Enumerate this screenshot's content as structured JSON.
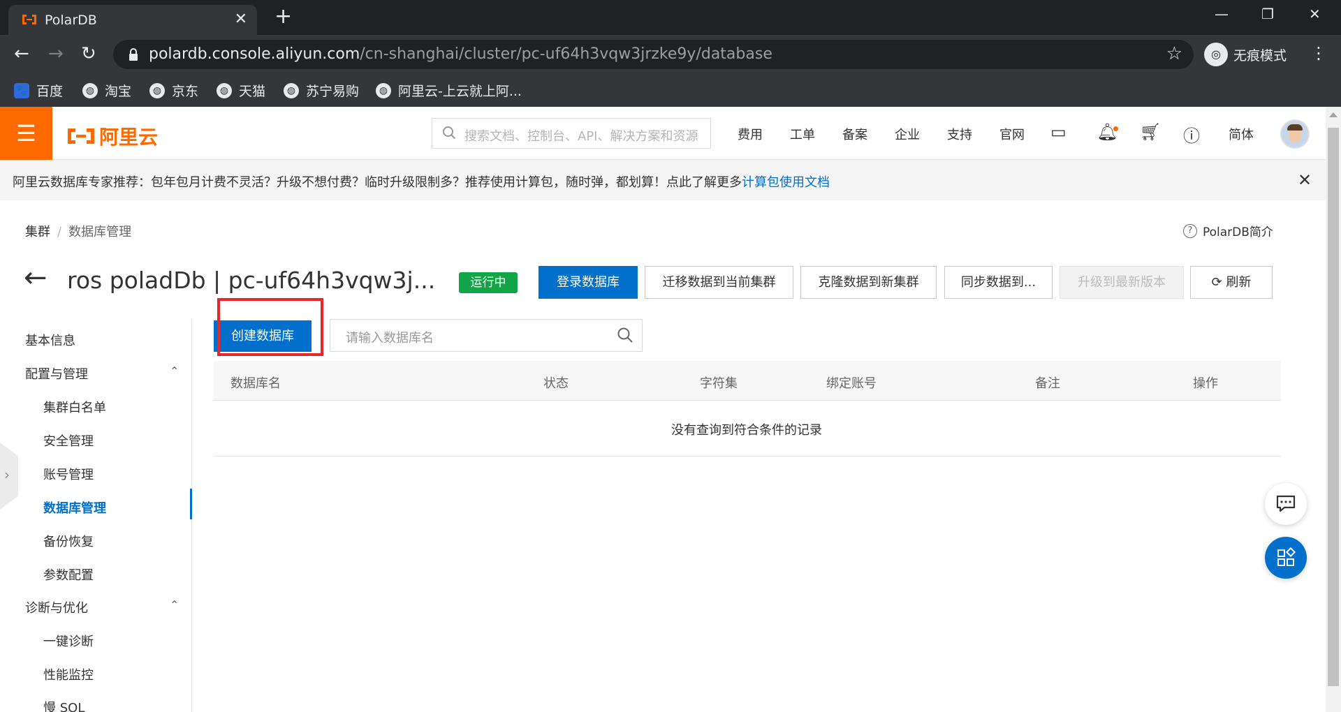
{
  "browser": {
    "tab_title": "PolarDB",
    "url_host": "polardb.console.aliyun.com",
    "url_path": "/cn-shanghai/cluster/pc-uf64h3vqw3jrzke9y/database",
    "incognito_label": "无痕模式",
    "bookmarks": [
      "百度",
      "淘宝",
      "京东",
      "天猫",
      "苏宁易购",
      "阿里云-上云就上阿..."
    ]
  },
  "header": {
    "logo_text": "阿里云",
    "search_placeholder": "搜索文档、控制台、API、解决方案和资源",
    "links": [
      "费用",
      "工单",
      "备案",
      "企业",
      "支持",
      "官网"
    ],
    "lang": "简体"
  },
  "notice": {
    "text": "阿里云数据库专家推荐：包年包月计费不灵活？升级不想付费？临时升级限制多？推荐使用计算包，随时弹，都划算！点此了解更多",
    "link": "计算包使用文档"
  },
  "breadcrumb": [
    "集群",
    "数据库管理"
  ],
  "help_link": "PolarDB简介",
  "page": {
    "title": "ros poladDb | pc-uf64h3vqw3j...",
    "status": "运行中",
    "actions": {
      "login": "登录数据库",
      "migrate": "迁移数据到当前集群",
      "clone": "克隆数据到新集群",
      "sync": "同步数据到...",
      "upgrade": "升级到最新版本",
      "refresh": "刷新"
    }
  },
  "sidebar": {
    "basic": "基本信息",
    "config_group": "配置与管理",
    "config_items": [
      "集群白名单",
      "安全管理",
      "账号管理",
      "数据库管理",
      "备份恢复",
      "参数配置"
    ],
    "diag_group": "诊断与优化",
    "diag_items": [
      "一键诊断",
      "性能监控",
      "慢 SQL"
    ]
  },
  "db": {
    "create_label": "创建数据库",
    "search_placeholder": "请输入数据库名",
    "columns": [
      "数据库名",
      "状态",
      "字符集",
      "绑定账号",
      "备注",
      "操作"
    ],
    "empty_text": "没有查询到符合条件的记录"
  },
  "colors": {
    "accent": "#0070cc",
    "brand": "#ff6a00",
    "running": "#11a548",
    "highlight": "#e8262b"
  }
}
